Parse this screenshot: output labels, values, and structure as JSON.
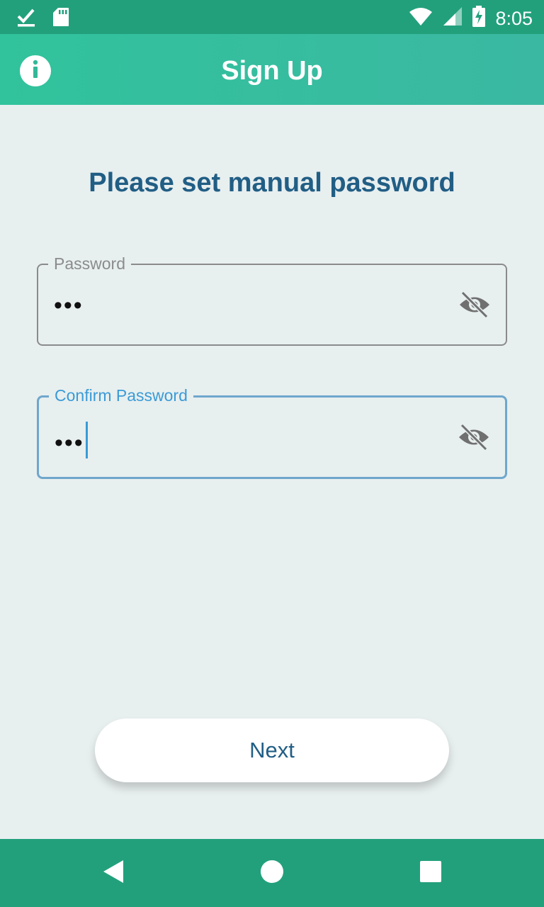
{
  "status_bar": {
    "time": "8:05",
    "icons": [
      "download-done-icon",
      "sd-card-icon",
      "wifi-icon",
      "signal-icon",
      "battery-charging-icon"
    ]
  },
  "app_bar": {
    "title": "Sign Up",
    "info_icon": "info-icon"
  },
  "main": {
    "heading": "Please set manual password",
    "password_field": {
      "label": "Password",
      "value": "•••",
      "visibility_icon": "eye-off-icon"
    },
    "confirm_field": {
      "label": "Confirm Password",
      "value": "•••",
      "visibility_icon": "eye-off-icon"
    },
    "next_button": "Next"
  },
  "nav_bar": {
    "icons": [
      "back-icon",
      "home-icon",
      "recents-icon"
    ]
  },
  "colors": {
    "status_bar": "#22a07c",
    "app_bar": "#31c39c",
    "heading": "#215e85",
    "focus": "#3a9bd6",
    "background": "#e8efef"
  }
}
